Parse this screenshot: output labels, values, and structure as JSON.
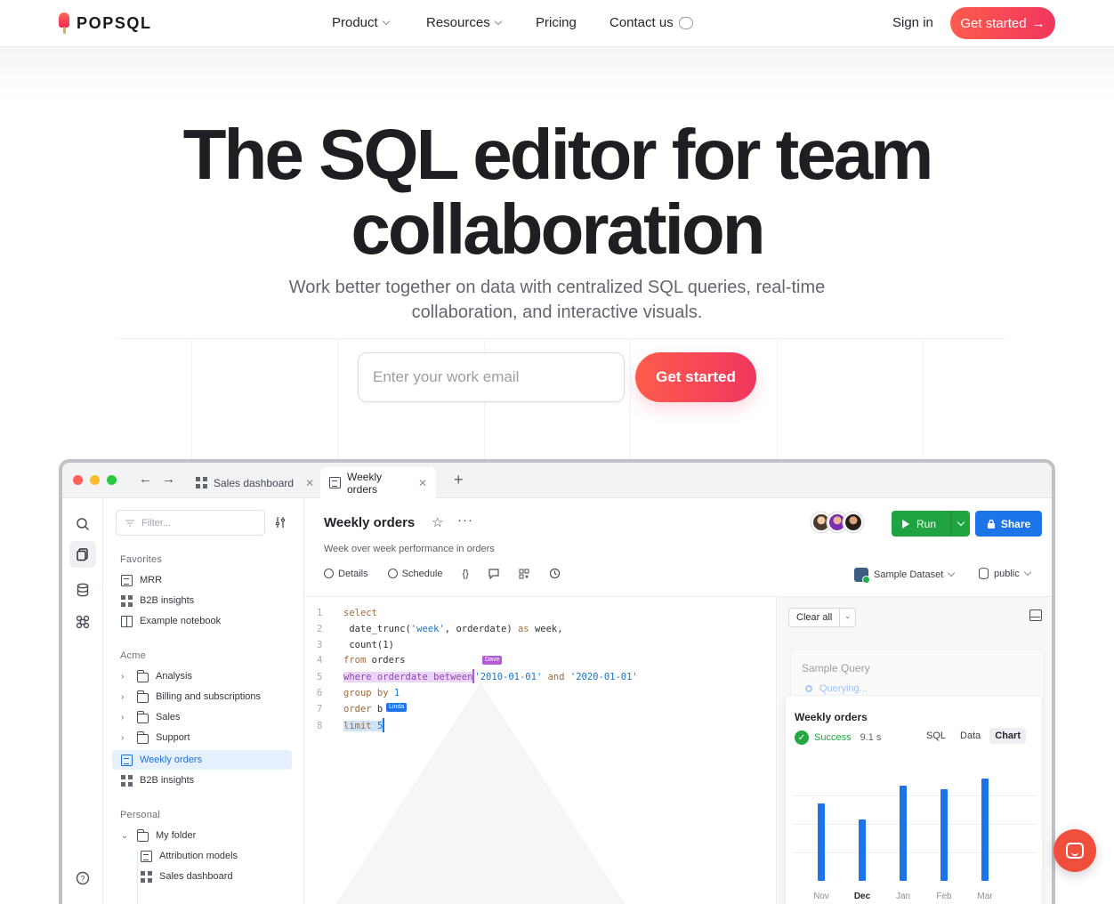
{
  "nav": {
    "logo_text": "POPSQL",
    "items": [
      {
        "label": "Product",
        "has_chevron": true
      },
      {
        "label": "Resources",
        "has_chevron": true
      },
      {
        "label": "Pricing",
        "has_chevron": false
      },
      {
        "label": "Contact us",
        "has_chevron": false
      }
    ],
    "sign_in": "Sign in",
    "cta": "Get started",
    "cta_arrow": "→"
  },
  "hero": {
    "title_line1": "The SQL editor for team",
    "title_line2": "collaboration",
    "subtitle": "Work better together on data with centralized SQL queries, real-time collaboration, and interactive visuals.",
    "email_placeholder": "Enter your work email",
    "cta": "Get started"
  },
  "app": {
    "tabs": [
      {
        "label": "Sales dashboard",
        "icon": "grid-icon",
        "active": false
      },
      {
        "label": "Weekly orders",
        "icon": "document-icon",
        "active": true
      }
    ],
    "sidebar": {
      "filter_placeholder": "Filter...",
      "favorites_heading": "Favorites",
      "favorites": [
        {
          "label": "MRR",
          "icon": "document-icon"
        },
        {
          "label": "B2B insights",
          "icon": "grid-icon"
        },
        {
          "label": "Example notebook",
          "icon": "book-icon"
        }
      ],
      "acme_heading": "Acme",
      "acme": [
        {
          "label": "Analysis",
          "icon": "folder-icon"
        },
        {
          "label": "Billing and subscriptions",
          "icon": "folder-icon"
        },
        {
          "label": "Sales",
          "icon": "folder-icon"
        },
        {
          "label": "Support",
          "icon": "folder-icon"
        },
        {
          "label": "Weekly orders",
          "icon": "document-icon",
          "selected": true
        },
        {
          "label": "B2B insights",
          "icon": "grid-icon"
        }
      ],
      "personal_heading": "Personal",
      "personal": [
        {
          "label": "My folder",
          "icon": "folder-open-icon"
        },
        {
          "label": "Attribution models",
          "icon": "document-icon"
        },
        {
          "label": "Sales dashboard",
          "icon": "grid-icon"
        }
      ]
    },
    "query": {
      "title": "Weekly orders",
      "description": "Week over week performance in orders",
      "tools": [
        "Details",
        "Schedule"
      ],
      "run_label": "Run",
      "share_label": "Share",
      "dataset": "Sample Dataset",
      "schema": "public"
    },
    "editor": {
      "line_numbers": [
        "1",
        "2",
        "3",
        "4",
        "5",
        "6",
        "7",
        "8"
      ],
      "dave_tag": "Dave",
      "linda_tag": "Linda"
    },
    "results": {
      "clear_all": "Clear all",
      "sample_title": "Sample Query",
      "sample_status": "Querying...",
      "card_title": "Weekly orders",
      "status": "Success",
      "duration": "9.1 s",
      "tabs": [
        {
          "label": "SQL",
          "active": false
        },
        {
          "label": "Data",
          "active": false
        },
        {
          "label": "Chart",
          "active": true
        }
      ]
    }
  },
  "chart_data": {
    "type": "bar",
    "categories": [
      "Nov",
      "Dec",
      "Jan",
      "Feb",
      "Mar"
    ],
    "bold_category": "Dec",
    "values": [
      0.82,
      0.65,
      1.0,
      0.97,
      1.08
    ],
    "ylim": [
      0,
      1.2
    ],
    "grid": true,
    "colors": {
      "bar": "#1d74e8"
    }
  },
  "colors": {
    "brand_red": "#f0365e",
    "run_green": "#20a341",
    "share_blue": "#1d74e8"
  }
}
